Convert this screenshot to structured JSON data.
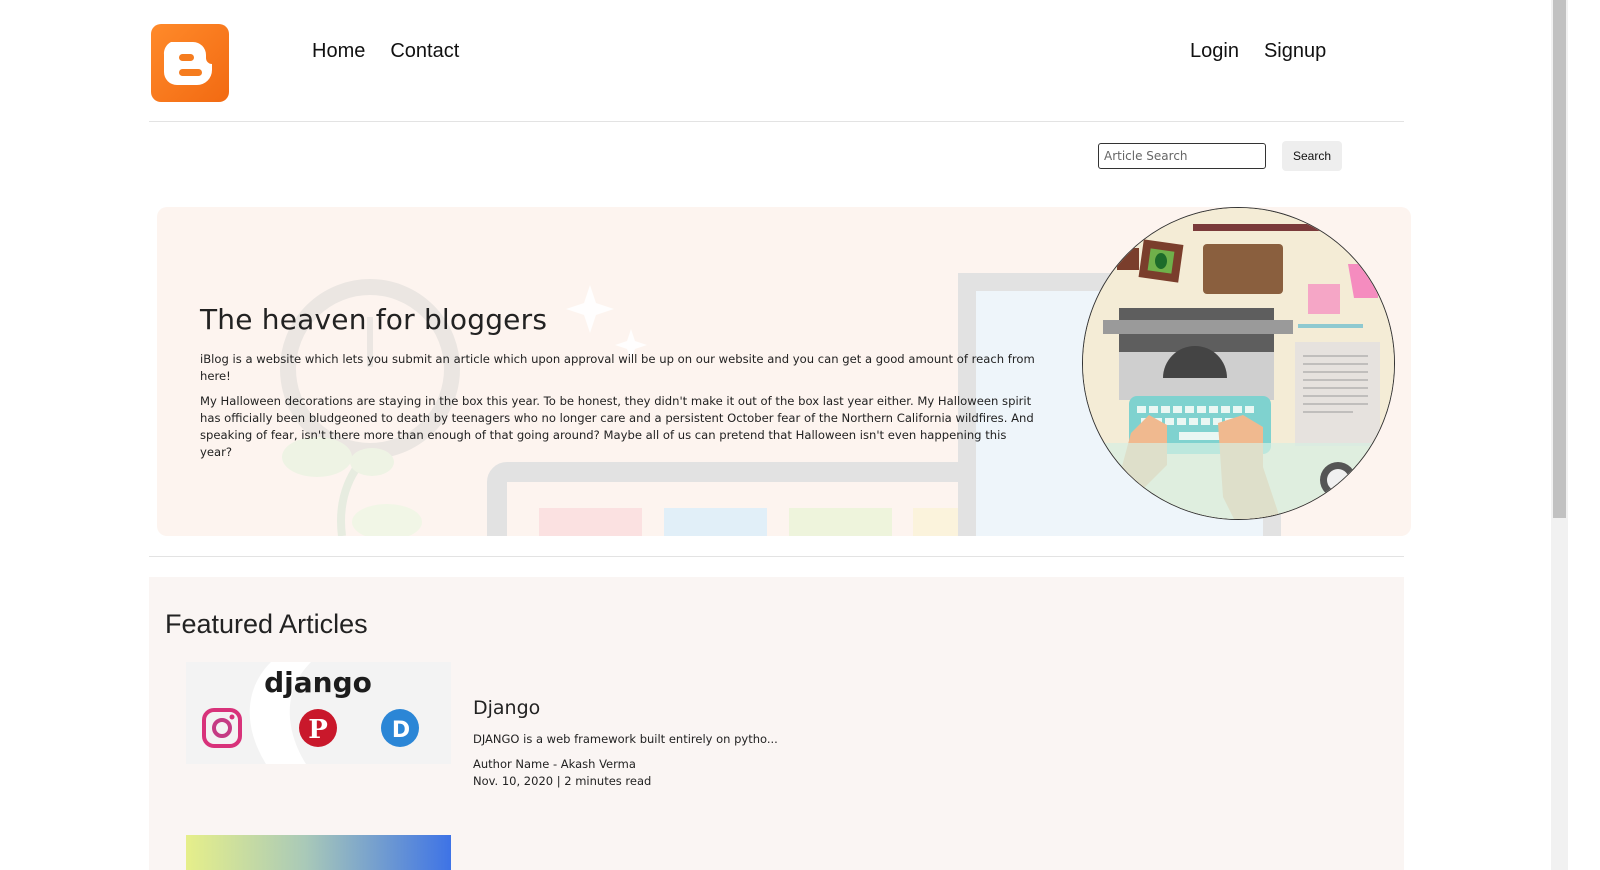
{
  "header": {
    "logo_alt": "Blogger",
    "nav_left": [
      "Home",
      "Contact"
    ],
    "nav_right": [
      "Login",
      "Signup"
    ]
  },
  "search": {
    "placeholder": "Article Search",
    "button_label": "Search"
  },
  "hero": {
    "title": "The heaven for bloggers",
    "paragraph_1": "iBlog is a website which lets you submit an article which upon approval will be up on our website and you can get a good amount of reach from here!",
    "paragraph_2": "My Halloween decorations are staying in the box this year. To be honest, they didn't make it out of the box last year either. My Halloween spirit has officially been bludgeoned to death by teenagers who no longer care and a persistent October fear of the Northern California wildfires. And speaking of fear, isn't there more than enough of that going around? Maybe all of us can pretend that Halloween isn't even happening this year?"
  },
  "featured": {
    "title": "Featured Articles",
    "articles": [
      {
        "thumb_text": "django",
        "title": "Django",
        "excerpt": "DJANGO is a web framework built entirely on pytho...",
        "author": "Author Name - Akash Verma",
        "meta": "Nov. 10, 2020 | 2 minutes read"
      }
    ]
  },
  "colors": {
    "brand_orange": "#f57c1f",
    "hero_bg": "#fdf4ef",
    "featured_bg": "#faf5f3"
  }
}
